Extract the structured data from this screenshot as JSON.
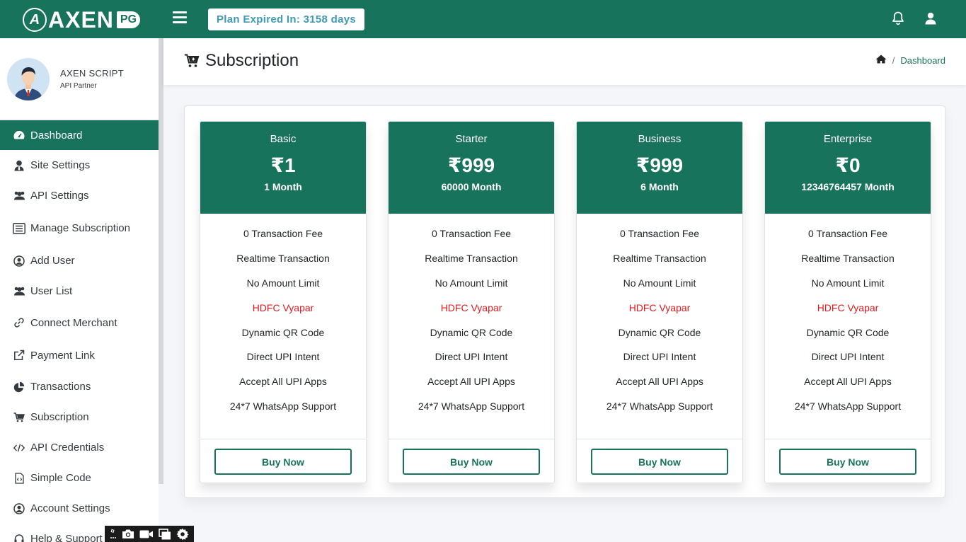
{
  "header": {
    "brand_text": "AXEN",
    "brand_badge": "PG",
    "plan_expiry": "Plan Expired In: 3158 days",
    "icons": [
      "hamburger-icon",
      "bell-icon",
      "user-icon"
    ]
  },
  "sidebar": {
    "user_name": "AXEN SCRIPT",
    "user_role": "API Partner",
    "items": [
      {
        "label": "Dashboard",
        "icon": "dashboard-icon"
      },
      {
        "label": "Site Settings",
        "icon": "user-tie-icon"
      },
      {
        "label": "API Settings",
        "icon": "users-icon"
      },
      {
        "label": "Manage Subscription",
        "icon": "list-icon"
      },
      {
        "label": "Add User",
        "icon": "user-circle-icon"
      },
      {
        "label": "User List",
        "icon": "users-icon"
      },
      {
        "label": "Connect Merchant",
        "icon": "link-icon"
      },
      {
        "label": "Payment Link",
        "icon": "external-link-icon"
      },
      {
        "label": "Transactions",
        "icon": "pie-chart-icon"
      },
      {
        "label": "Subscription",
        "icon": "cart-icon"
      },
      {
        "label": "API Credentials",
        "icon": "code-icon"
      },
      {
        "label": "Simple Code",
        "icon": "file-code-icon"
      },
      {
        "label": "Account Settings",
        "icon": "user-circle-icon"
      },
      {
        "label": "Help & Support",
        "icon": "headset-icon"
      }
    ]
  },
  "page": {
    "title": "Subscription",
    "breadcrumb_separator": "/",
    "breadcrumb_current": "Dashboard"
  },
  "plans": [
    {
      "name": "Basic",
      "price": "₹1",
      "duration": "1 Month",
      "button": "Buy Now"
    },
    {
      "name": "Starter",
      "price": "₹999",
      "duration": "60000 Month",
      "button": "Buy Now"
    },
    {
      "name": "Business",
      "price": "₹999",
      "duration": "6 Month",
      "button": "Buy Now"
    },
    {
      "name": "Enterprise",
      "price": "₹0",
      "duration": "12346764457 Month",
      "button": "Buy Now"
    }
  ],
  "features": [
    "0 Transaction Fee",
    "Realtime Transaction",
    "No Amount Limit",
    "HDFC Vyapar",
    "Dynamic QR Code",
    "Direct UPI Intent",
    "Accept All UPI Apps",
    "24*7 WhatsApp Support"
  ],
  "colors": {
    "brand": "#17735b",
    "plan_text": "#3e9bb4",
    "highlight_feature": "#e0191c"
  }
}
